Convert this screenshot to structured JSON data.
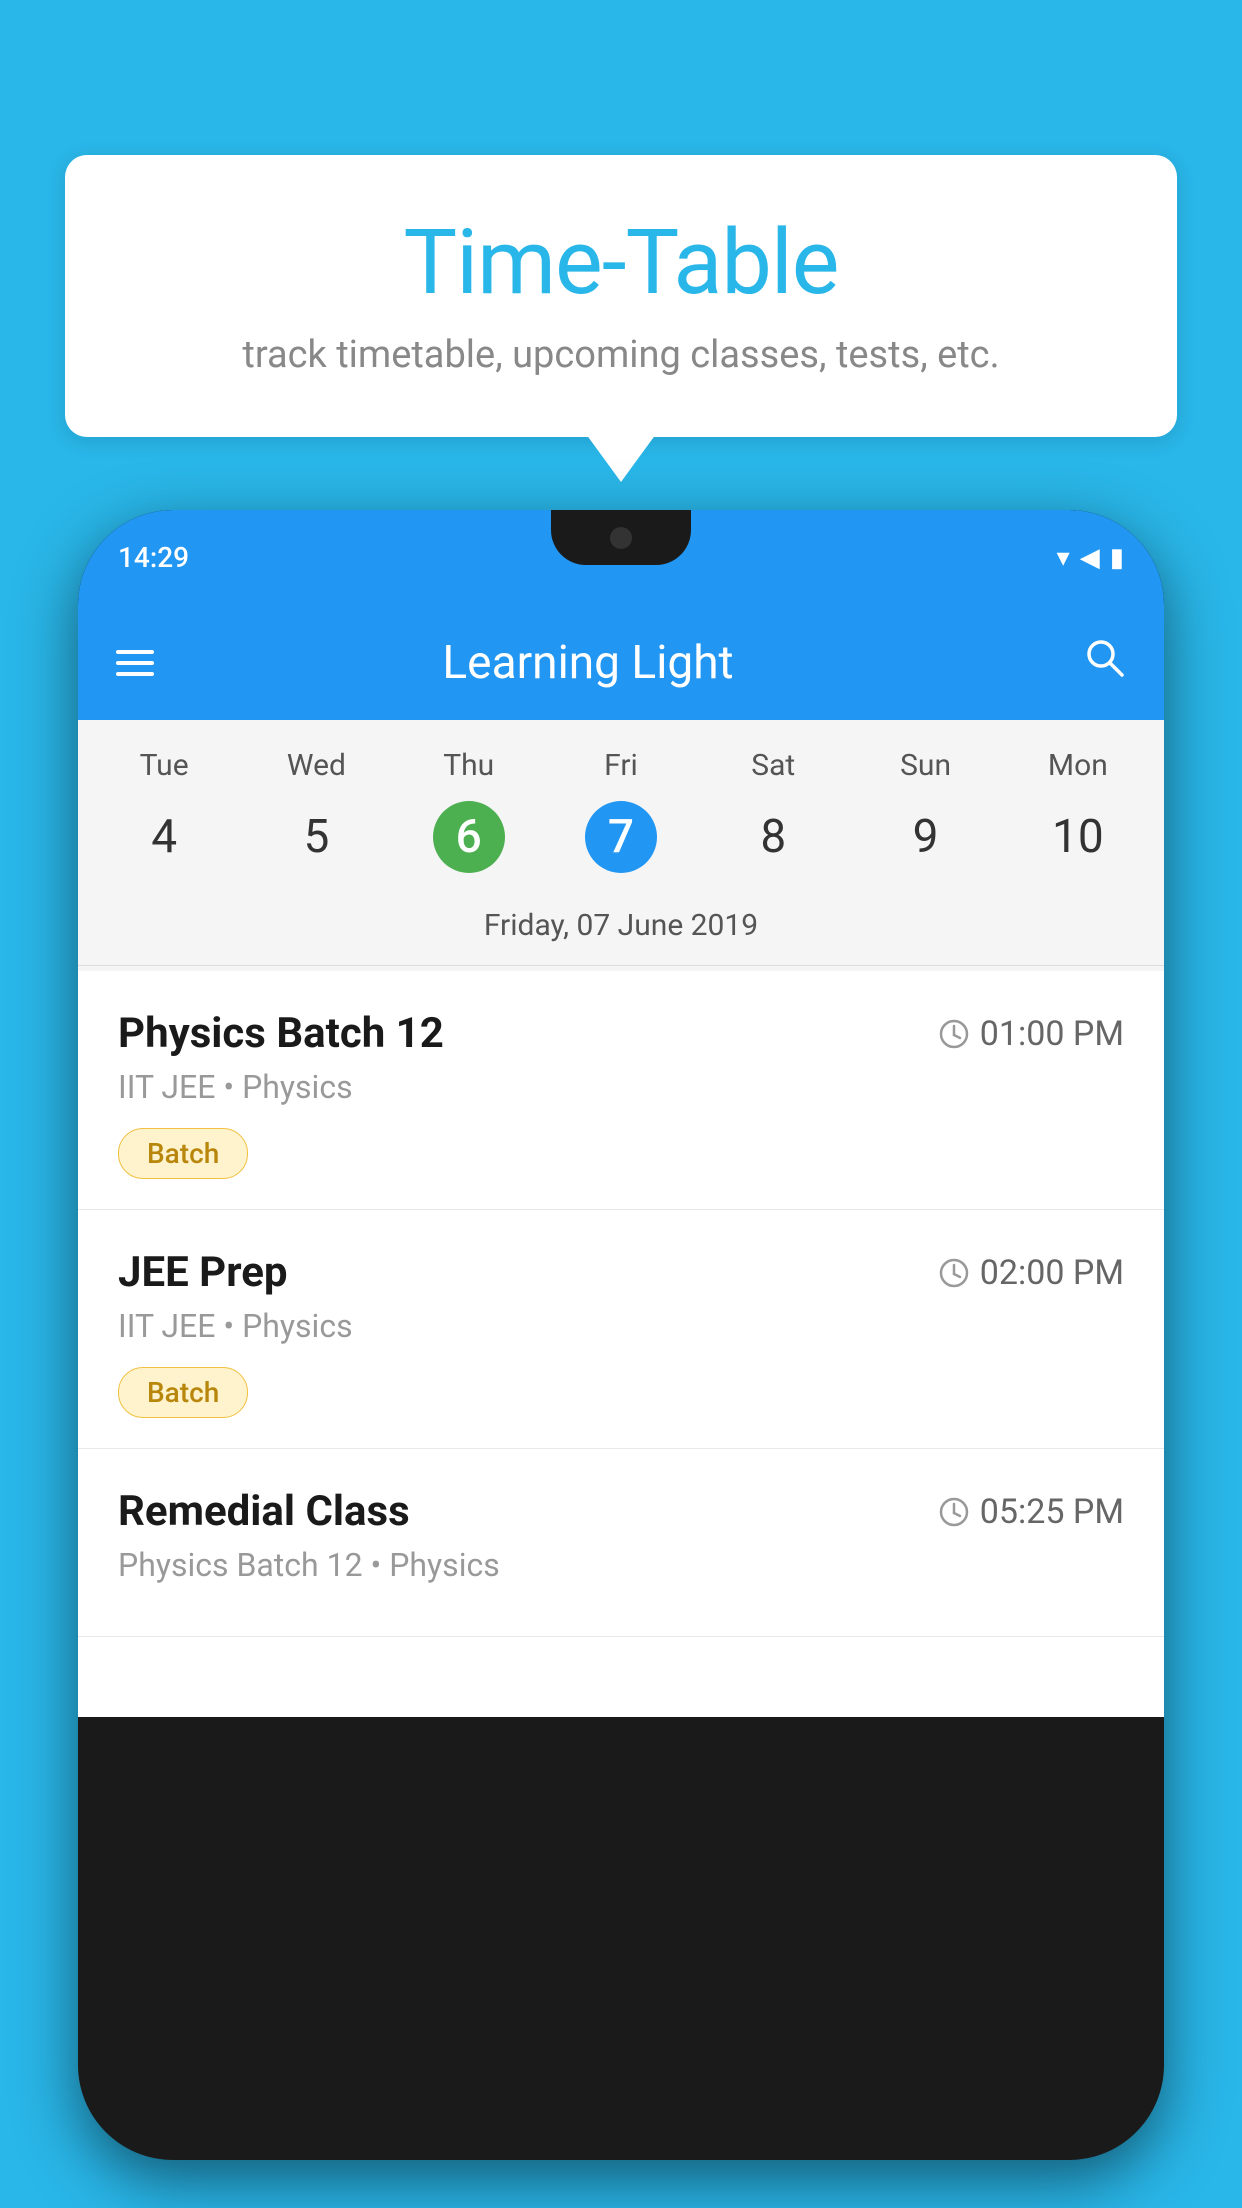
{
  "background_color": "#29b6e8",
  "speech_bubble": {
    "title": "Time-Table",
    "subtitle": "track timetable, upcoming classes, tests, etc."
  },
  "app": {
    "status_bar": {
      "time": "14:29"
    },
    "title": "Learning Light",
    "calendar": {
      "days": [
        {
          "label": "Tue",
          "number": "4"
        },
        {
          "label": "Wed",
          "number": "5"
        },
        {
          "label": "Thu",
          "number": "6",
          "state": "today"
        },
        {
          "label": "Fri",
          "number": "7",
          "state": "selected"
        },
        {
          "label": "Sat",
          "number": "8"
        },
        {
          "label": "Sun",
          "number": "9"
        },
        {
          "label": "Mon",
          "number": "10"
        }
      ],
      "selected_date": "Friday, 07 June 2019"
    },
    "schedule": [
      {
        "name": "Physics Batch 12",
        "time": "01:00 PM",
        "detail": "IIT JEE • Physics",
        "badge": "Batch"
      },
      {
        "name": "JEE Prep",
        "time": "02:00 PM",
        "detail": "IIT JEE • Physics",
        "badge": "Batch"
      },
      {
        "name": "Remedial Class",
        "time": "05:25 PM",
        "detail": "Physics Batch 12 • Physics",
        "badge": null
      }
    ]
  }
}
